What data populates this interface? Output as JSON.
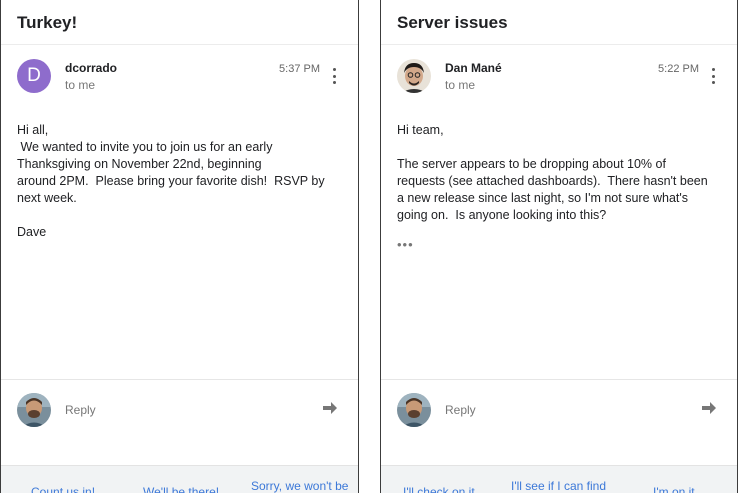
{
  "left": {
    "subject": "Turkey!",
    "sender": "dcorrado",
    "avatar_letter": "D",
    "to": "to me",
    "time": "5:37 PM",
    "body": [
      "Hi all,",
      " We wanted to invite you to join us for an early",
      "Thanksgiving on November 22nd, beginning",
      "around 2PM.  Please bring your favorite dish!  RSVP by",
      "next week.",
      "",
      "Dave"
    ],
    "reply_placeholder": "Reply",
    "suggestions": [
      "Count us in!",
      "We'll be there!",
      "Sorry, we won't be"
    ]
  },
  "right": {
    "subject": "Server issues",
    "sender": "Dan Mané",
    "to": "to me",
    "time": "5:22 PM",
    "body": [
      "Hi team,",
      "",
      "The server appears to be dropping about 10% of",
      "requests (see attached dashboards).  There hasn't been",
      "a new release since last night, so I'm not sure what's",
      "going on.  Is anyone looking into this?"
    ],
    "ellipsis": "•••",
    "reply_placeholder": "Reply",
    "suggestions": [
      "I'll check on it",
      "I'll see if I can find",
      "I'm on it"
    ]
  },
  "icons": {
    "more": "more-vert-icon",
    "send": "send-arrow-icon"
  },
  "colors": {
    "avatar_purple": "#8e6ccc",
    "link_blue": "#3c78d8"
  }
}
